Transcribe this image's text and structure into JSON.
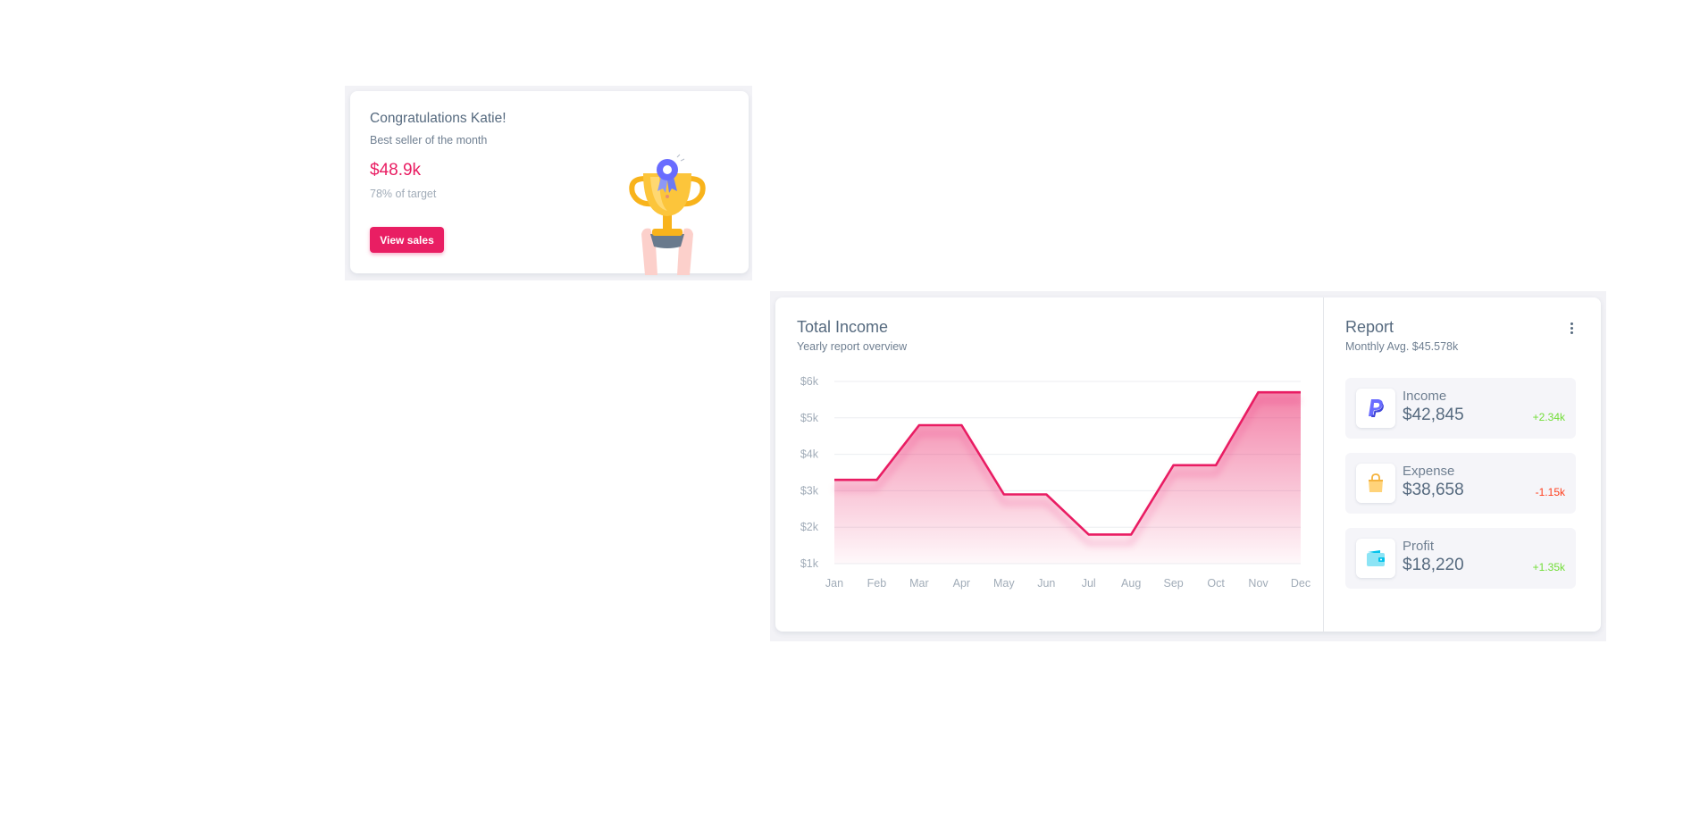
{
  "congrats": {
    "title": "Congratulations Katie!",
    "subtitle": "Best seller of the month",
    "amount": "$48.9k",
    "target": "78% of target",
    "button_label": "View sales"
  },
  "income": {
    "title": "Total Income",
    "subtitle": "Yearly report overview"
  },
  "chart_data": {
    "type": "line",
    "categories": [
      "Jan",
      "Feb",
      "Mar",
      "Apr",
      "May",
      "Jun",
      "Jul",
      "Aug",
      "Sep",
      "Oct",
      "Nov",
      "Dec"
    ],
    "series": [
      {
        "values": [
          3.3,
          3.3,
          4.8,
          4.8,
          2.9,
          2.9,
          1.8,
          1.8,
          3.7,
          3.7,
          5.7,
          5.7
        ]
      }
    ],
    "y_ticks": [
      "$1k",
      "$2k",
      "$3k",
      "$4k",
      "$5k",
      "$6k"
    ],
    "ylim": [
      1,
      6
    ],
    "grid": true,
    "fill": "area gradient",
    "line_color": "#e91e63"
  },
  "report": {
    "title": "Report",
    "subtitle": "Monthly Avg. $45.578k",
    "items": [
      {
        "label": "Income",
        "value": "$42,845",
        "delta": "+2.34k",
        "delta_color": "#71dd37",
        "icon": "paypal-icon"
      },
      {
        "label": "Expense",
        "value": "$38,658",
        "delta": "-1.15k",
        "delta_color": "#ff3e1d",
        "icon": "shopping-bag-icon"
      },
      {
        "label": "Profit",
        "value": "$18,220",
        "delta": "+1.35k",
        "delta_color": "#71dd37",
        "icon": "wallet-icon"
      }
    ]
  }
}
